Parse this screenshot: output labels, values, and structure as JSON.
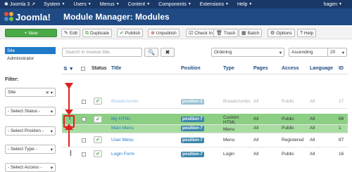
{
  "topbar": {
    "brand": "Joomla 3",
    "menus": [
      "System",
      "Users",
      "Menus",
      "Content",
      "Components",
      "Extensions",
      "Help"
    ],
    "user": "hagen"
  },
  "header": {
    "logo_text": "Joomla!",
    "title": "Module Manager: Modules"
  },
  "toolbar": {
    "new": "New",
    "edit": "Edit",
    "duplicate": "Duplicate",
    "publish": "Publish",
    "unpublish": "Unpublish",
    "checkin": "Check In",
    "trash": "Trash",
    "batch": "Batch",
    "options": "Options",
    "help": "Help"
  },
  "sidebar": {
    "items": [
      "Site",
      "Administrator"
    ],
    "filter_label": "Filter:"
  },
  "filters": {
    "client": "Site",
    "status": "- Select Status -",
    "position": "- Select Position -",
    "type": "- Select Type -",
    "access": "- Select Access -"
  },
  "search": {
    "placeholder": "Search in module title."
  },
  "list_controls": {
    "ordering": "Ordering",
    "direction": "Ascending",
    "limit": "20"
  },
  "columns": [
    "Status",
    "Title",
    "Position",
    "Type",
    "Pages",
    "Access",
    "Language",
    "ID"
  ],
  "rows": [
    {
      "title": "Breadcrumbs",
      "position": "position-2",
      "type": "Breadcrumbs",
      "pages": "All",
      "access": "Public",
      "language": "All",
      "id": "17"
    },
    {
      "title": "My HTML",
      "position": "position-7",
      "type": "Custom HTML",
      "pages": "All",
      "access": "Public",
      "language": "All",
      "id": "88"
    },
    {
      "title": "Main Menu",
      "position": "position-7",
      "type": "Menu",
      "pages": "All",
      "access": "Public",
      "language": "All",
      "id": "1"
    },
    {
      "title": "User Menu",
      "position": "position-7",
      "type": "Menu",
      "pages": "All",
      "access": "Registered",
      "language": "All",
      "id": "87"
    },
    {
      "title": "Login Form",
      "position": "position-7",
      "type": "Login",
      "pages": "All",
      "access": "Public",
      "language": "All",
      "id": "16"
    }
  ],
  "colors": {
    "topbar": "#1a3867",
    "header": "#1f4a83",
    "accent": "#1f7ac8",
    "green": "#4aa947",
    "highlight": "#8ccf84",
    "arrow": "#e02020"
  }
}
